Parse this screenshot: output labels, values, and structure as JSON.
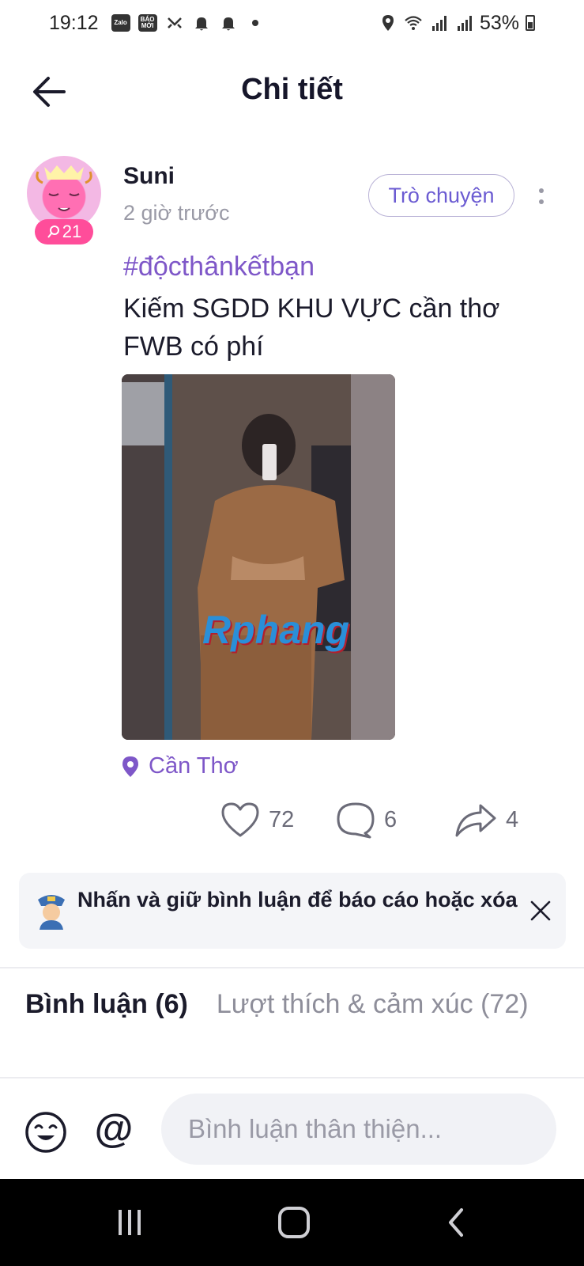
{
  "status_bar": {
    "time": "19:12",
    "app_icons": [
      "Zalo",
      "BÁO MỚI"
    ],
    "battery": "53%"
  },
  "header": {
    "title": "Chi tiết"
  },
  "post": {
    "username": "Suni",
    "avatar_badge": "21",
    "timestamp": "2 giờ trước",
    "chat_button": "Trò chuyện",
    "hashtag": "#độcthânkếtbạn",
    "text_line1": "Kiếm SGDD KHU VỰC cần thơ",
    "text_line2": "FWB có phí",
    "image_watermark": "Rphang",
    "location": "Cần Thơ",
    "likes": "72",
    "comments": "6",
    "shares": "4"
  },
  "hint": {
    "text": "Nhấn và giữ bình luận để báo cáo hoặc xóa"
  },
  "tabs": {
    "comments": "Bình luận (6)",
    "likes": "Lượt thích & cảm xúc (72)"
  },
  "comment_bar": {
    "placeholder": "Bình luận thân thiện...",
    "mention": "@"
  },
  "colors": {
    "accent": "#7e57c8",
    "badge": "#ff4d9a",
    "text": "#1b1b2b",
    "muted": "#9a9aa6"
  },
  "icons": [
    "back-arrow-icon",
    "more-vertical-icon",
    "location-pin-icon",
    "heart-icon",
    "comment-bubble-icon",
    "share-arrow-icon",
    "police-icon",
    "close-icon",
    "emoji-icon",
    "recents-icon",
    "home-icon",
    "nav-back-icon"
  ]
}
